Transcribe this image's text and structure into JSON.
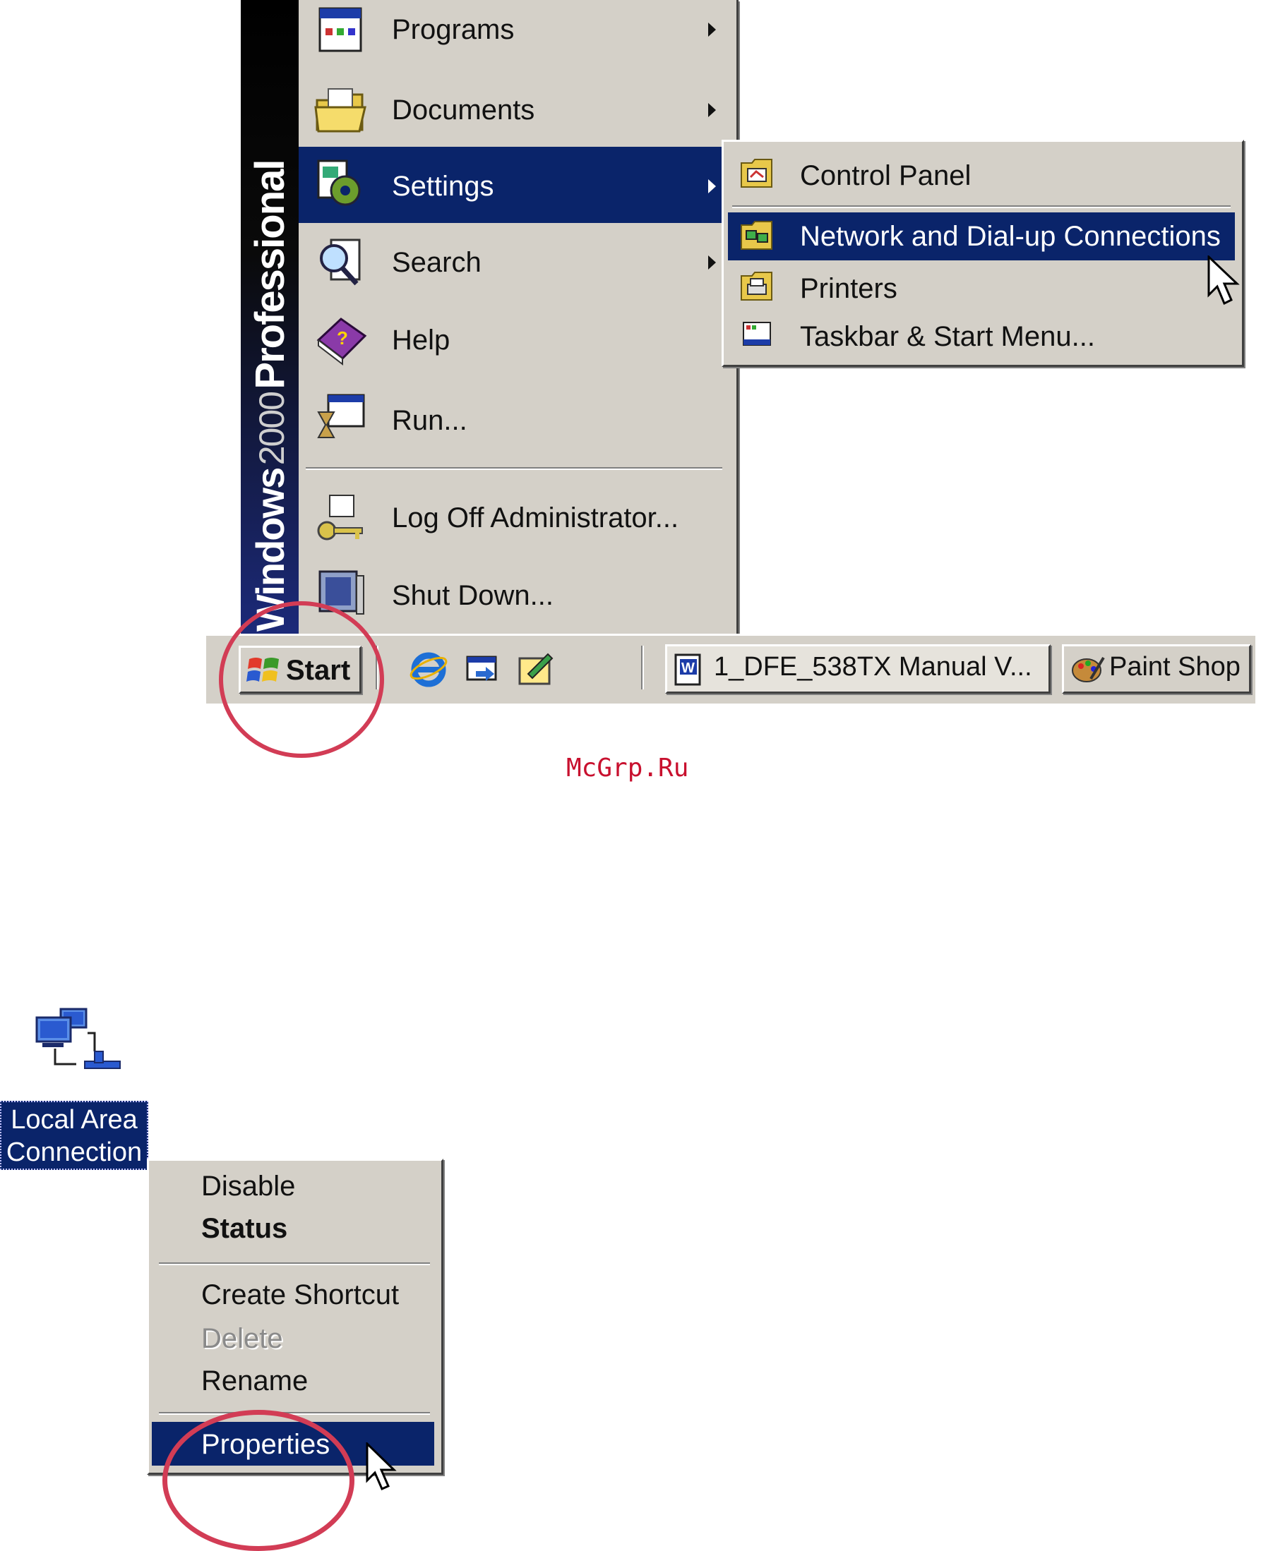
{
  "start_menu": {
    "banner": {
      "brand": "Windows",
      "version": "2000",
      "edition": "Professional"
    },
    "items": [
      {
        "label": "Programs",
        "icon": "programs-icon",
        "submenu": true
      },
      {
        "label": "Documents",
        "icon": "documents-folder-icon",
        "submenu": true
      },
      {
        "label": "Settings",
        "icon": "settings-icon",
        "submenu": true,
        "highlighted": true
      },
      {
        "label": "Search",
        "icon": "search-icon",
        "submenu": true
      },
      {
        "label": "Help",
        "icon": "help-book-icon",
        "submenu": false
      },
      {
        "label": "Run...",
        "icon": "run-icon",
        "submenu": false
      },
      {
        "label": "Log Off Administrator...",
        "icon": "log-off-key-icon",
        "submenu": false
      },
      {
        "label": "Shut Down...",
        "icon": "shut-down-icon",
        "submenu": false
      }
    ]
  },
  "settings_submenu": {
    "items": [
      {
        "label": "Control Panel",
        "icon": "control-panel-icon"
      },
      {
        "label": "Network and Dial-up Connections",
        "icon": "network-connections-icon",
        "highlighted": true
      },
      {
        "label": "Printers",
        "icon": "printers-icon"
      },
      {
        "label": "Taskbar & Start Menu...",
        "icon": "taskbar-icon"
      }
    ]
  },
  "taskbar": {
    "start_label": "Start",
    "quick_launch": [
      "internet-explorer-icon",
      "show-desktop-icon",
      "outlook-express-icon"
    ],
    "tasks": [
      {
        "label": "1_DFE_538TX  Manual V...",
        "icon": "word-document-icon"
      },
      {
        "label": "Paint Shop",
        "icon": "paint-shop-icon"
      }
    ]
  },
  "watermark": "McGrp.Ru",
  "desktop_icon": {
    "line1": "Local Area",
    "line2": "Connection",
    "icon": "network-lan-icon"
  },
  "context_menu": {
    "items": [
      {
        "label": "Disable",
        "bold": false,
        "disabled": false
      },
      {
        "label": "Status",
        "bold": true,
        "disabled": false
      },
      {
        "label": "Create Shortcut",
        "bold": false,
        "disabled": false
      },
      {
        "label": "Delete",
        "bold": false,
        "disabled": true
      },
      {
        "label": "Rename",
        "bold": false,
        "disabled": false
      },
      {
        "label": "Properties",
        "bold": false,
        "disabled": false,
        "highlighted": true
      }
    ]
  },
  "colors": {
    "menu_grey": "#d4d0c8",
    "highlight": "#0a246a",
    "annotation_circle": "#d23c55",
    "watermark": "#c8102e"
  }
}
